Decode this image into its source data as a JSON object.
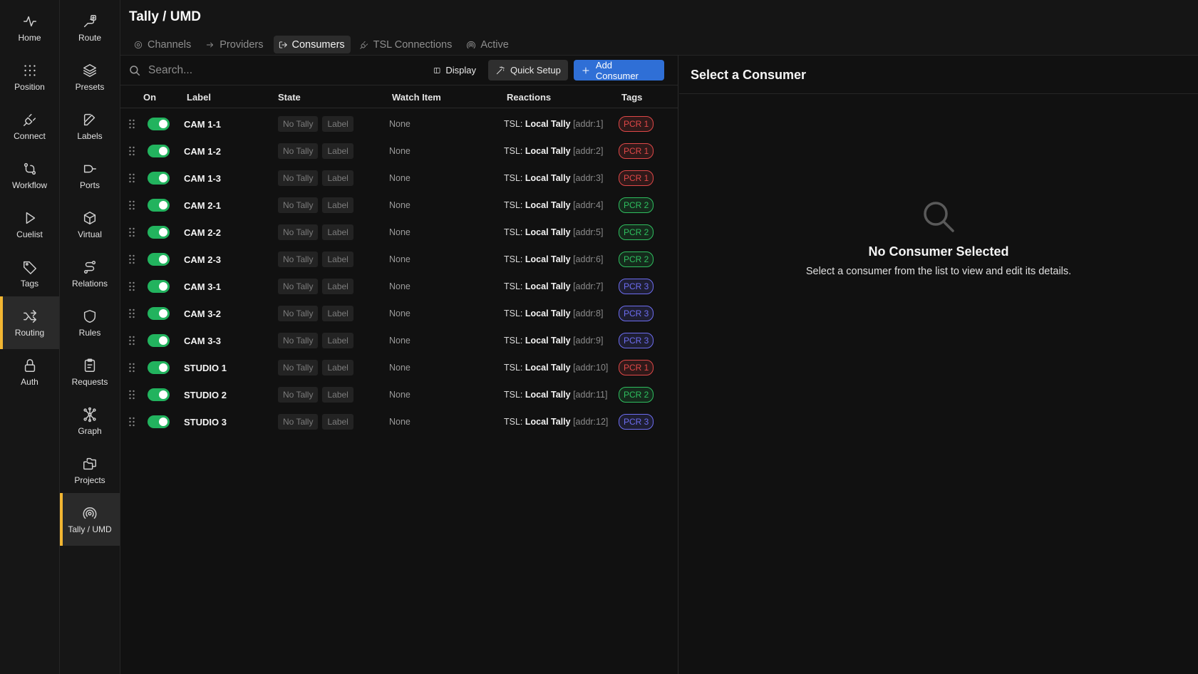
{
  "colors": {
    "accent_active": "#f2b632",
    "toggle_on": "#22b35e",
    "primary_button": "#2f6fd6",
    "tag_pcr1": "#e04848",
    "tag_pcr2": "#2fbf5f",
    "tag_pcr3": "#6d6df0"
  },
  "nav_primary": [
    {
      "label": "Home",
      "icon": "activity-icon"
    },
    {
      "label": "Position",
      "icon": "grid-dots-icon"
    },
    {
      "label": "Connect",
      "icon": "plug-icon"
    },
    {
      "label": "Workflow",
      "icon": "workflow-icon"
    },
    {
      "label": "Cuelist",
      "icon": "play-icon"
    },
    {
      "label": "Tags",
      "icon": "tag-icon"
    },
    {
      "label": "Routing",
      "icon": "shuffle-icon",
      "active": true
    },
    {
      "label": "Auth",
      "icon": "lock-icon"
    }
  ],
  "nav_secondary": [
    {
      "label": "Route",
      "icon": "route-icon"
    },
    {
      "label": "Presets",
      "icon": "layers-icon"
    },
    {
      "label": "Labels",
      "icon": "edit-icon"
    },
    {
      "label": "Ports",
      "icon": "port-icon"
    },
    {
      "label": "Virtual",
      "icon": "cube-icon"
    },
    {
      "label": "Relations",
      "icon": "relations-icon"
    },
    {
      "label": "Rules",
      "icon": "shield-icon"
    },
    {
      "label": "Requests",
      "icon": "clipboard-icon"
    },
    {
      "label": "Graph",
      "icon": "graph-icon"
    },
    {
      "label": "Projects",
      "icon": "folders-icon"
    },
    {
      "label": "Tally / UMD",
      "icon": "broadcast-icon",
      "active": true
    }
  ],
  "header": {
    "title": "Tally / UMD",
    "tabs": [
      {
        "label": "Channels",
        "icon": "channel-icon"
      },
      {
        "label": "Providers",
        "icon": "arrow-in-icon"
      },
      {
        "label": "Consumers",
        "icon": "arrow-out-icon",
        "active": true
      },
      {
        "label": "TSL Connections",
        "icon": "plug-icon"
      },
      {
        "label": "Active",
        "icon": "broadcast-icon"
      }
    ]
  },
  "toolbar": {
    "search_placeholder": "Search...",
    "display_label": "Display",
    "quick_setup_label": "Quick Setup",
    "add_consumer_label": "Add Consumer"
  },
  "table": {
    "columns": {
      "on": "On",
      "label": "Label",
      "state": "State",
      "watch": "Watch Item",
      "reactions": "Reactions",
      "tags": "Tags"
    },
    "state_pills": [
      "No Tally",
      "Label"
    ],
    "rows": [
      {
        "on": true,
        "label": "CAM 1-1",
        "watch": "None",
        "react_prefix": "TSL:",
        "react_target": "Local Tally",
        "react_addr": "[addr:1]",
        "tag": "PCR 1",
        "tag_color": "#e04848"
      },
      {
        "on": true,
        "label": "CAM 1-2",
        "watch": "None",
        "react_prefix": "TSL:",
        "react_target": "Local Tally",
        "react_addr": "[addr:2]",
        "tag": "PCR 1",
        "tag_color": "#e04848"
      },
      {
        "on": true,
        "label": "CAM 1-3",
        "watch": "None",
        "react_prefix": "TSL:",
        "react_target": "Local Tally",
        "react_addr": "[addr:3]",
        "tag": "PCR 1",
        "tag_color": "#e04848"
      },
      {
        "on": true,
        "label": "CAM 2-1",
        "watch": "None",
        "react_prefix": "TSL:",
        "react_target": "Local Tally",
        "react_addr": "[addr:4]",
        "tag": "PCR 2",
        "tag_color": "#2fbf5f"
      },
      {
        "on": true,
        "label": "CAM 2-2",
        "watch": "None",
        "react_prefix": "TSL:",
        "react_target": "Local Tally",
        "react_addr": "[addr:5]",
        "tag": "PCR 2",
        "tag_color": "#2fbf5f"
      },
      {
        "on": true,
        "label": "CAM 2-3",
        "watch": "None",
        "react_prefix": "TSL:",
        "react_target": "Local Tally",
        "react_addr": "[addr:6]",
        "tag": "PCR 2",
        "tag_color": "#2fbf5f"
      },
      {
        "on": true,
        "label": "CAM 3-1",
        "watch": "None",
        "react_prefix": "TSL:",
        "react_target": "Local Tally",
        "react_addr": "[addr:7]",
        "tag": "PCR 3",
        "tag_color": "#6d6df0"
      },
      {
        "on": true,
        "label": "CAM 3-2",
        "watch": "None",
        "react_prefix": "TSL:",
        "react_target": "Local Tally",
        "react_addr": "[addr:8]",
        "tag": "PCR 3",
        "tag_color": "#6d6df0"
      },
      {
        "on": true,
        "label": "CAM 3-3",
        "watch": "None",
        "react_prefix": "TSL:",
        "react_target": "Local Tally",
        "react_addr": "[addr:9]",
        "tag": "PCR 3",
        "tag_color": "#6d6df0"
      },
      {
        "on": true,
        "label": "STUDIO 1",
        "watch": "None",
        "react_prefix": "TSL:",
        "react_target": "Local Tally",
        "react_addr": "[addr:10]",
        "tag": "PCR 1",
        "tag_color": "#e04848"
      },
      {
        "on": true,
        "label": "STUDIO 2",
        "watch": "None",
        "react_prefix": "TSL:",
        "react_target": "Local Tally",
        "react_addr": "[addr:11]",
        "tag": "PCR 2",
        "tag_color": "#2fbf5f"
      },
      {
        "on": true,
        "label": "STUDIO 3",
        "watch": "None",
        "react_prefix": "TSL:",
        "react_target": "Local Tally",
        "react_addr": "[addr:12]",
        "tag": "PCR 3",
        "tag_color": "#6d6df0"
      }
    ]
  },
  "detail": {
    "title": "Select a Consumer",
    "empty_title": "No Consumer Selected",
    "empty_subtitle": "Select a consumer from the list to view and edit its details."
  }
}
